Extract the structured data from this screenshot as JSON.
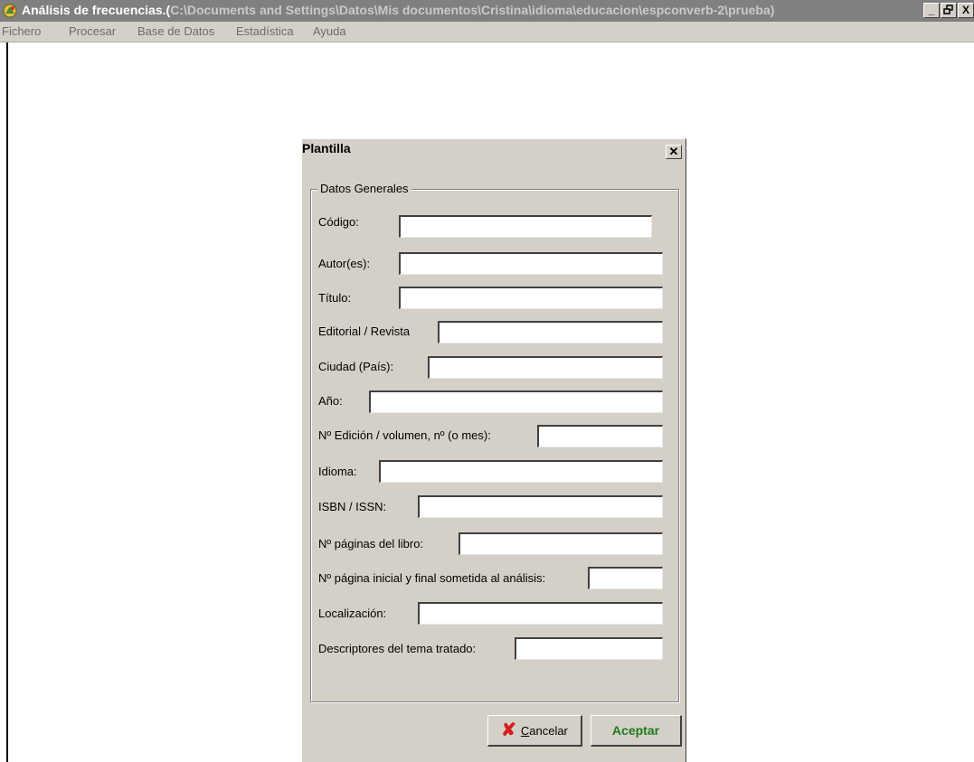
{
  "window": {
    "title": "Análisis de frecuencias.(",
    "title_path": "C:\\Documents and Settings\\Datos\\Mis documentos\\Cristina\\idioma\\educacion\\espconverb-2\\prueba)",
    "minimize": "_",
    "maximize": "▫",
    "close": "X"
  },
  "menu": [
    "Fichero",
    "Procesar",
    "Base de Datos",
    "Estadística",
    "Ayuda"
  ],
  "dialog": {
    "title": "Plantilla",
    "close": "✕",
    "group_title": "Datos Generales",
    "fields": [
      {
        "label": "Código:",
        "value": ""
      },
      {
        "label": "Autor(es):",
        "value": ""
      },
      {
        "label": "Título:",
        "value": ""
      },
      {
        "label": "Editorial / Revista",
        "value": ""
      },
      {
        "label": "Ciudad (País):",
        "value": ""
      },
      {
        "label": "Año:",
        "value": ""
      },
      {
        "label": "Nº Edición / volumen, nº  (o mes):",
        "value": ""
      },
      {
        "label": "Idioma:",
        "value": ""
      },
      {
        "label": "ISBN / ISSN:",
        "value": ""
      },
      {
        "label": "Nº páginas del libro:",
        "value": ""
      },
      {
        "label": "Nº página inicial y final sometida al análisis:",
        "value": ""
      },
      {
        "label": "Localización:",
        "value": ""
      },
      {
        "label": "Descriptores del tema tratado:",
        "value": ""
      }
    ],
    "cancel_label_first": "C",
    "cancel_label_rest": "ancelar",
    "cancel_icon": "✘",
    "accept_label": "Aceptar"
  },
  "colors": {
    "titlebar_inactive": "#808080",
    "dialog_face": "#d4d0c8",
    "accept_text": "#1c7a1c",
    "cancel_icon": "#d42020"
  }
}
